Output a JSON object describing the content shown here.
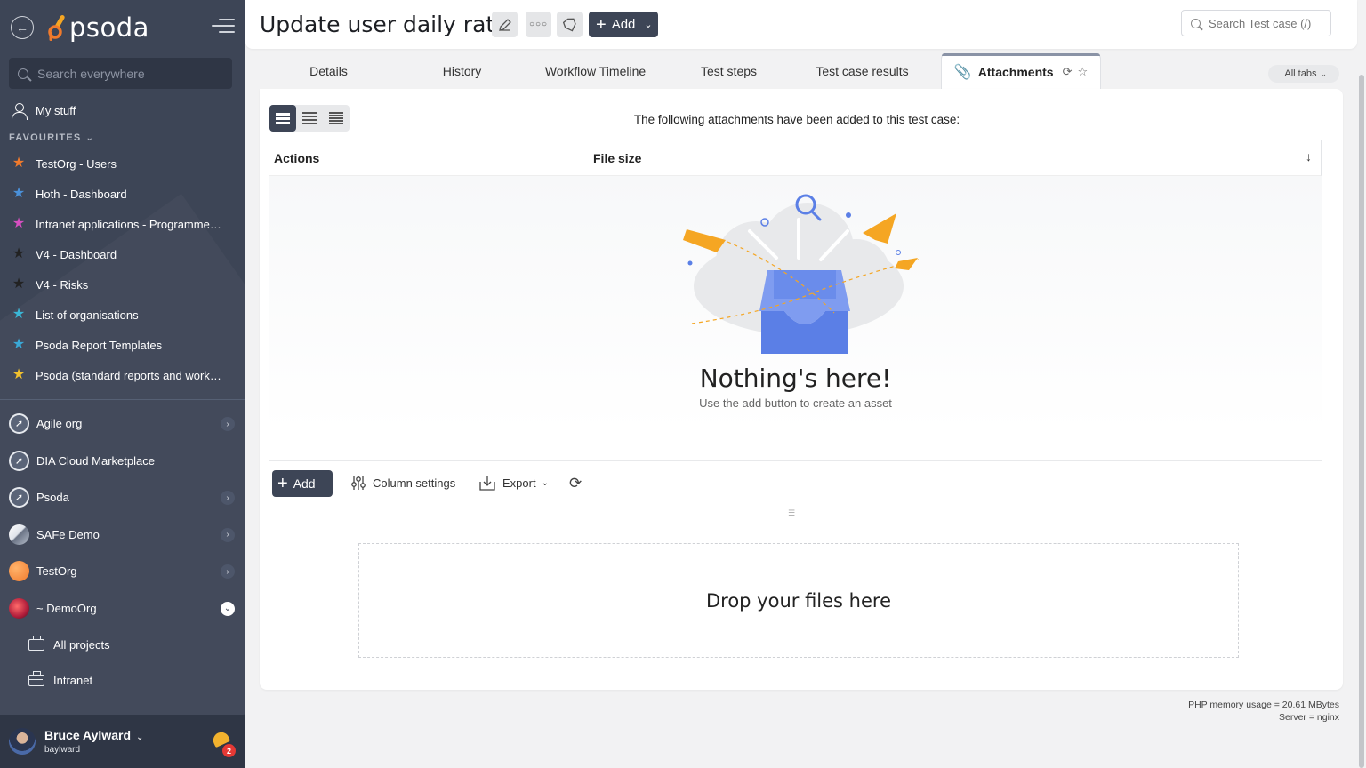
{
  "app": {
    "logo_text": "psoda"
  },
  "sidebar": {
    "search_placeholder": "Search everywhere",
    "my_stuff": "My stuff",
    "favourites_label": "FAVOURITES",
    "favourites": [
      {
        "label": "TestOrg - Users",
        "color": "#f07a2c"
      },
      {
        "label": "Hoth - Dashboard",
        "color": "#4a90d9"
      },
      {
        "label": "Intranet applications - Programme…",
        "color": "#d64fc0"
      },
      {
        "label": "V4 - Dashboard",
        "color": "#222222"
      },
      {
        "label": "V4 - Risks",
        "color": "#222222"
      },
      {
        "label": "List of organisations",
        "color": "#3ab6d6"
      },
      {
        "label": "Psoda Report Templates",
        "color": "#3aa8d6"
      },
      {
        "label": "Psoda (standard reports and work…",
        "color": "#f2c12e"
      }
    ],
    "orgs": [
      {
        "label": "Agile org"
      },
      {
        "label": "DIA Cloud Marketplace"
      },
      {
        "label": "Psoda"
      },
      {
        "label": "SAFe Demo"
      },
      {
        "label": "TestOrg"
      },
      {
        "label": "~ DemoOrg"
      }
    ],
    "sub_items": [
      {
        "label": "All projects"
      },
      {
        "label": "Intranet"
      }
    ],
    "user": {
      "name": "Bruce Aylward",
      "login": "baylward",
      "notifications": "2"
    }
  },
  "header": {
    "title": "Update user daily rate",
    "add_label": "Add",
    "search_placeholder": "Search Test case (/)"
  },
  "tabs": [
    {
      "label": "Details"
    },
    {
      "label": "History"
    },
    {
      "label": "Workflow Timeline"
    },
    {
      "label": "Test steps"
    },
    {
      "label": "Test case results"
    },
    {
      "label": "Attachments",
      "active": true
    }
  ],
  "all_tabs_label": "All tabs",
  "attachments": {
    "message": "The following attachments have been added to this test case:",
    "columns": [
      "Actions",
      "File size"
    ],
    "empty_title": "Nothing's here!",
    "empty_subtitle": "Use the add button to create an asset",
    "add_label": "Add",
    "column_settings_label": "Column settings",
    "export_label": "Export",
    "dropzone_label": "Drop your files here"
  },
  "footer": {
    "memory": "PHP memory usage = 20.61 MBytes",
    "server": "Server = nginx"
  }
}
